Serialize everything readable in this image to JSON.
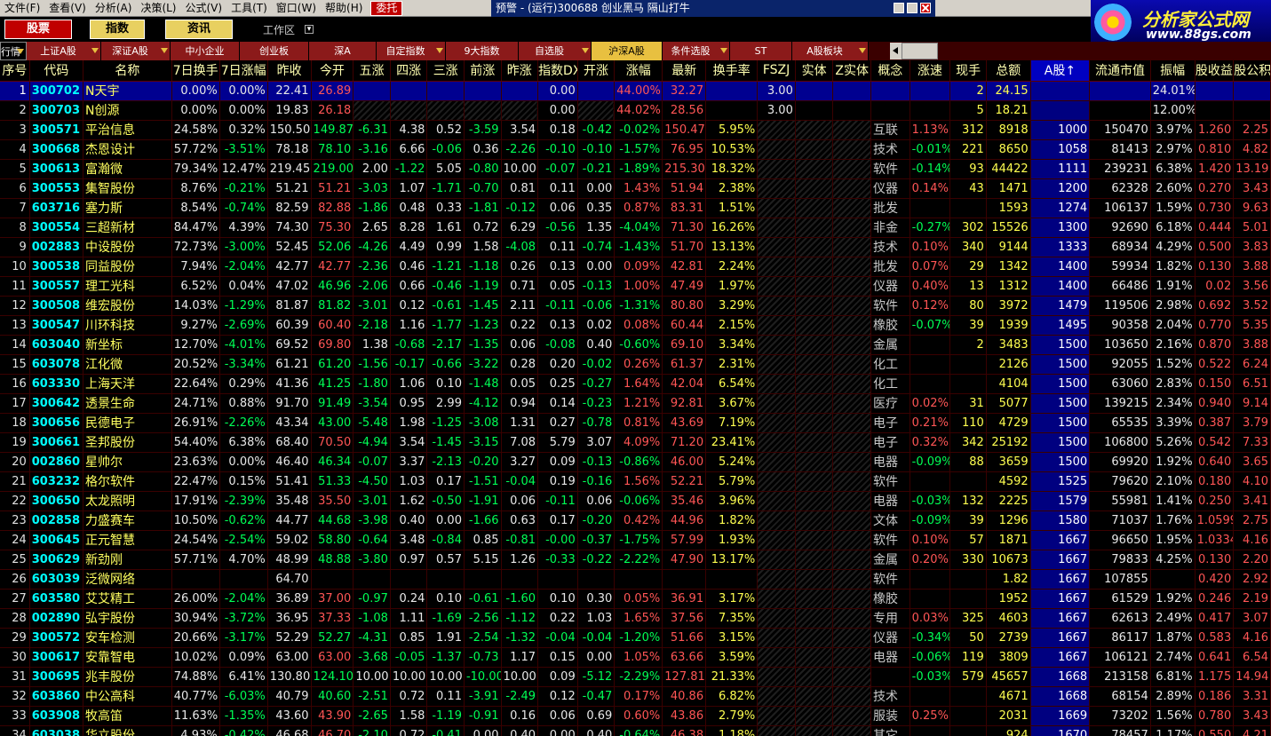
{
  "menu": {
    "items": [
      "文件(F)",
      "查看(V)",
      "分析(A)",
      "决策(L)",
      "公式(V)",
      "工具(T)",
      "窗口(W)",
      "帮助(H)"
    ],
    "active": "委托"
  },
  "window": {
    "title": "预警 - (运行)300688  创业黑马  隔山打牛"
  },
  "logo": {
    "name": "分析家公式网",
    "url": "www.88gs.com"
  },
  "toolbar": {
    "stock": "股票",
    "index": "指数",
    "info": "资讯",
    "workspace": "工作区"
  },
  "tabs": [
    {
      "label": "行情",
      "drop": true,
      "first": true
    },
    {
      "label": "上证A股",
      "drop": true
    },
    {
      "label": "深证A股",
      "drop": true
    },
    {
      "label": "中小企业",
      "drop": false
    },
    {
      "label": "创业板",
      "drop": false
    },
    {
      "label": "深A",
      "drop": false
    },
    {
      "label": "自定指数",
      "drop": true
    },
    {
      "label": "9大指数",
      "drop": false
    },
    {
      "label": "自选股",
      "drop": true
    },
    {
      "label": "沪深A股",
      "drop": false,
      "active": true
    },
    {
      "label": "条件选股",
      "drop": true
    },
    {
      "label": "ST",
      "drop": false
    },
    {
      "label": "A股板块",
      "drop": true
    }
  ],
  "columns": [
    "序号",
    "代码",
    "名称",
    "7日换手",
    "7日涨幅",
    "昨收",
    "今开",
    "五涨",
    "四涨",
    "三涨",
    "前涨",
    "昨涨",
    "指数DX",
    "开涨",
    "涨幅",
    "最新",
    "换手率",
    "FSZJ",
    "实体",
    "Z实体",
    "概念",
    "涨速",
    "现手",
    "总额",
    "A股↑",
    "流通市值",
    "振幅",
    "股收益",
    "股公积"
  ],
  "rows": [
    [
      "1",
      "300702",
      "N天宇",
      "0.00%",
      "0.00%",
      "22.41",
      "26.89",
      "",
      "",
      "",
      "",
      "",
      "0.00",
      "",
      "44.00%",
      "32.27",
      "",
      "3.00",
      "",
      "",
      "",
      "",
      "2",
      "24.15",
      "",
      "",
      "24.01%",
      "",
      ""
    ],
    [
      "2",
      "300703",
      "N创源",
      "0.00%",
      "0.00%",
      "19.83",
      "26.18",
      "",
      "",
      "",
      "",
      "",
      "0.00",
      "",
      "44.02%",
      "28.56",
      "",
      "3.00",
      "",
      "",
      "",
      "",
      "5",
      "18.21",
      "",
      "",
      "12.00%",
      "",
      ""
    ],
    [
      "3",
      "300571",
      "平治信息",
      "24.58%",
      "0.32%",
      "150.50",
      "149.87",
      "-6.31",
      "4.38",
      "0.52",
      "-3.59",
      "3.54",
      "0.18",
      "-0.42",
      "-0.02%",
      "150.47",
      "5.95%",
      "",
      "",
      "",
      "互联",
      "1.13%",
      "312",
      "8918",
      "1000",
      "150470",
      "3.97%",
      "1.260",
      "2.25"
    ],
    [
      "4",
      "300668",
      "杰恩设计",
      "57.72%",
      "-3.51%",
      "78.18",
      "78.10",
      "-3.16",
      "6.66",
      "-0.06",
      "0.36",
      "-2.26",
      "-0.10",
      "-0.10",
      "-1.57%",
      "76.95",
      "10.53%",
      "",
      "",
      "",
      "技术",
      "-0.01%",
      "221",
      "8650",
      "1058",
      "81413",
      "2.97%",
      "0.810",
      "4.82"
    ],
    [
      "5",
      "300613",
      "富瀚微",
      "79.34%",
      "12.47%",
      "219.45",
      "219.00",
      "2.00",
      "-1.22",
      "5.05",
      "-0.80",
      "10.00",
      "-0.07",
      "-0.21",
      "-1.89%",
      "215.30",
      "18.32%",
      "",
      "",
      "",
      "软件",
      "-0.14%",
      "93",
      "44422",
      "1111",
      "239231",
      "6.38%",
      "1.420",
      "13.19"
    ],
    [
      "6",
      "300553",
      "集智股份",
      "8.76%",
      "-0.21%",
      "51.21",
      "51.21",
      "-3.03",
      "1.07",
      "-1.71",
      "-0.70",
      "0.81",
      "0.11",
      "0.00",
      "1.43%",
      "51.94",
      "2.38%",
      "",
      "",
      "",
      "仪器",
      "0.14%",
      "43",
      "1471",
      "1200",
      "62328",
      "2.60%",
      "0.270",
      "3.43"
    ],
    [
      "7",
      "603716",
      "塞力斯",
      "8.54%",
      "-0.74%",
      "82.59",
      "82.88",
      "-1.86",
      "0.48",
      "0.33",
      "-1.81",
      "-0.12",
      "0.06",
      "0.35",
      "0.87%",
      "83.31",
      "1.51%",
      "",
      "",
      "",
      "批发",
      "",
      "",
      "1593",
      "1274",
      "106137",
      "1.59%",
      "0.730",
      "9.63"
    ],
    [
      "8",
      "300554",
      "三超新材",
      "84.47%",
      "4.39%",
      "74.30",
      "75.30",
      "2.65",
      "8.28",
      "1.61",
      "0.72",
      "6.29",
      "-0.56",
      "1.35",
      "-4.04%",
      "71.30",
      "16.26%",
      "",
      "",
      "",
      "非金",
      "-0.27%",
      "302",
      "15526",
      "1300",
      "92690",
      "6.18%",
      "0.444",
      "5.01"
    ],
    [
      "9",
      "002883",
      "中设股份",
      "72.73%",
      "-3.00%",
      "52.45",
      "52.06",
      "-4.26",
      "4.49",
      "0.99",
      "1.58",
      "-4.08",
      "0.11",
      "-0.74",
      "-1.43%",
      "51.70",
      "13.13%",
      "",
      "",
      "",
      "技术",
      "0.10%",
      "340",
      "9144",
      "1333",
      "68934",
      "4.29%",
      "0.500",
      "3.83"
    ],
    [
      "10",
      "300538",
      "同益股份",
      "7.94%",
      "-2.04%",
      "42.77",
      "42.77",
      "-2.36",
      "0.46",
      "-1.21",
      "-1.18",
      "0.26",
      "0.13",
      "0.00",
      "0.09%",
      "42.81",
      "2.24%",
      "",
      "",
      "",
      "批发",
      "0.07%",
      "29",
      "1342",
      "1400",
      "59934",
      "1.82%",
      "0.130",
      "3.88"
    ],
    [
      "11",
      "300557",
      "理工光科",
      "6.52%",
      "0.04%",
      "47.02",
      "46.96",
      "-2.06",
      "0.66",
      "-0.46",
      "-1.19",
      "0.71",
      "0.05",
      "-0.13",
      "1.00%",
      "47.49",
      "1.97%",
      "",
      "",
      "",
      "仪器",
      "0.40%",
      "13",
      "1312",
      "1400",
      "66486",
      "1.91%",
      "0.02",
      "3.56"
    ],
    [
      "12",
      "300508",
      "维宏股份",
      "14.03%",
      "-1.29%",
      "81.87",
      "81.82",
      "-3.01",
      "0.12",
      "-0.61",
      "-1.45",
      "2.11",
      "-0.11",
      "-0.06",
      "-1.31%",
      "80.80",
      "3.29%",
      "",
      "",
      "",
      "软件",
      "0.12%",
      "80",
      "3972",
      "1479",
      "119506",
      "2.98%",
      "0.692",
      "3.52"
    ],
    [
      "13",
      "300547",
      "川环科技",
      "9.27%",
      "-2.69%",
      "60.39",
      "60.40",
      "-2.18",
      "1.16",
      "-1.77",
      "-1.23",
      "0.22",
      "0.13",
      "0.02",
      "0.08%",
      "60.44",
      "2.15%",
      "",
      "",
      "",
      "橡胶",
      "-0.07%",
      "39",
      "1939",
      "1495",
      "90358",
      "2.04%",
      "0.770",
      "5.35"
    ],
    [
      "14",
      "603040",
      "新坐标",
      "12.70%",
      "-4.01%",
      "69.52",
      "69.80",
      "1.38",
      "-0.68",
      "-2.17",
      "-1.35",
      "0.06",
      "-0.08",
      "0.40",
      "-0.60%",
      "69.10",
      "3.34%",
      "",
      "",
      "",
      "金属",
      "",
      "2",
      "3483",
      "1500",
      "103650",
      "2.16%",
      "0.870",
      "3.88"
    ],
    [
      "15",
      "603078",
      "江化微",
      "20.52%",
      "-3.34%",
      "61.21",
      "61.20",
      "-1.56",
      "-0.17",
      "-0.66",
      "-3.22",
      "0.28",
      "0.20",
      "-0.02",
      "0.26%",
      "61.37",
      "2.31%",
      "",
      "",
      "",
      "化工",
      "",
      "",
      "2126",
      "1500",
      "92055",
      "1.52%",
      "0.522",
      "6.24"
    ],
    [
      "16",
      "603330",
      "上海天洋",
      "22.64%",
      "0.29%",
      "41.36",
      "41.25",
      "-1.80",
      "1.06",
      "0.10",
      "-1.48",
      "0.05",
      "0.25",
      "-0.27",
      "1.64%",
      "42.04",
      "6.54%",
      "",
      "",
      "",
      "化工",
      "",
      "",
      "4104",
      "1500",
      "63060",
      "2.83%",
      "0.150",
      "6.51"
    ],
    [
      "17",
      "300642",
      "透景生命",
      "24.71%",
      "0.88%",
      "91.70",
      "91.49",
      "-3.54",
      "0.95",
      "2.99",
      "-4.12",
      "0.94",
      "0.14",
      "-0.23",
      "1.21%",
      "92.81",
      "3.67%",
      "",
      "",
      "",
      "医疗",
      "0.02%",
      "31",
      "5077",
      "1500",
      "139215",
      "2.34%",
      "0.940",
      "9.14"
    ],
    [
      "18",
      "300656",
      "民德电子",
      "26.91%",
      "-2.26%",
      "43.34",
      "43.00",
      "-5.48",
      "1.98",
      "-1.25",
      "-3.08",
      "1.31",
      "0.27",
      "-0.78",
      "0.81%",
      "43.69",
      "7.19%",
      "",
      "",
      "",
      "电子",
      "0.21%",
      "110",
      "4729",
      "1500",
      "65535",
      "3.39%",
      "0.387",
      "3.79"
    ],
    [
      "19",
      "300661",
      "圣邦股份",
      "54.40%",
      "6.38%",
      "68.40",
      "70.50",
      "-4.94",
      "3.54",
      "-1.45",
      "-3.15",
      "7.08",
      "5.79",
      "3.07",
      "4.09%",
      "71.20",
      "23.41%",
      "",
      "",
      "",
      "电子",
      "0.32%",
      "342",
      "25192",
      "1500",
      "106800",
      "5.26%",
      "0.542",
      "7.33"
    ],
    [
      "20",
      "002860",
      "星帅尔",
      "23.63%",
      "0.00%",
      "46.40",
      "46.34",
      "-0.07",
      "3.37",
      "-2.13",
      "-0.20",
      "3.27",
      "0.09",
      "-0.13",
      "-0.86%",
      "46.00",
      "5.24%",
      "",
      "",
      "",
      "电器",
      "-0.09%",
      "88",
      "3659",
      "1500",
      "69920",
      "1.92%",
      "0.640",
      "3.65"
    ],
    [
      "21",
      "603232",
      "格尔软件",
      "22.47%",
      "0.15%",
      "51.41",
      "51.33",
      "-4.50",
      "1.03",
      "0.17",
      "-1.51",
      "-0.04",
      "0.19",
      "-0.16",
      "1.56%",
      "52.21",
      "5.79%",
      "",
      "",
      "",
      "软件",
      "",
      "",
      "4592",
      "1525",
      "79620",
      "2.10%",
      "0.180",
      "4.10"
    ],
    [
      "22",
      "300650",
      "太龙照明",
      "17.91%",
      "-2.39%",
      "35.48",
      "35.50",
      "-3.01",
      "1.62",
      "-0.50",
      "-1.91",
      "0.06",
      "-0.11",
      "0.06",
      "-0.06%",
      "35.46",
      "3.96%",
      "",
      "",
      "",
      "电器",
      "-0.03%",
      "132",
      "2225",
      "1579",
      "55981",
      "1.41%",
      "0.250",
      "3.41"
    ],
    [
      "23",
      "002858",
      "力盛赛车",
      "10.50%",
      "-0.62%",
      "44.77",
      "44.68",
      "-3.98",
      "0.40",
      "0.00",
      "-1.66",
      "0.63",
      "0.17",
      "-0.20",
      "0.42%",
      "44.96",
      "1.82%",
      "",
      "",
      "",
      "文体",
      "-0.09%",
      "39",
      "1296",
      "1580",
      "71037",
      "1.76%",
      "1.0599",
      "2.75"
    ],
    [
      "24",
      "300645",
      "正元智慧",
      "24.54%",
      "-2.54%",
      "59.02",
      "58.80",
      "-0.64",
      "3.48",
      "-0.84",
      "0.85",
      "-0.81",
      "-0.00",
      "-0.37",
      "-1.75%",
      "57.99",
      "1.93%",
      "",
      "",
      "",
      "软件",
      "0.10%",
      "57",
      "1871",
      "1667",
      "96650",
      "1.95%",
      "1.0334",
      "4.16"
    ],
    [
      "25",
      "300629",
      "新劲刚",
      "57.71%",
      "4.70%",
      "48.99",
      "48.88",
      "-3.80",
      "0.97",
      "0.57",
      "5.15",
      "1.26",
      "-0.33",
      "-0.22",
      "-2.22%",
      "47.90",
      "13.17%",
      "",
      "",
      "",
      "金属",
      "0.20%",
      "330",
      "10673",
      "1667",
      "79833",
      "4.25%",
      "0.130",
      "2.20"
    ],
    [
      "26",
      "603039",
      "泛微网络",
      "",
      "",
      "64.70",
      "",
      "",
      "",
      "",
      "",
      "",
      "",
      "",
      "",
      "",
      "",
      "",
      "",
      "",
      "软件",
      "",
      "",
      "1.82",
      "1667",
      "107855",
      "",
      "0.420",
      "2.92"
    ],
    [
      "27",
      "603580",
      "艾艾精工",
      "26.00%",
      "-2.04%",
      "36.89",
      "37.00",
      "-0.97",
      "0.24",
      "0.10",
      "-0.61",
      "-1.60",
      "0.10",
      "0.30",
      "0.05%",
      "36.91",
      "3.17%",
      "",
      "",
      "",
      "橡胶",
      "",
      "",
      "1952",
      "1667",
      "61529",
      "1.92%",
      "0.246",
      "2.19"
    ],
    [
      "28",
      "002890",
      "弘宇股份",
      "30.94%",
      "-3.72%",
      "36.95",
      "37.33",
      "-1.08",
      "1.11",
      "-1.69",
      "-2.56",
      "-1.12",
      "0.22",
      "1.03",
      "1.65%",
      "37.56",
      "7.35%",
      "",
      "",
      "",
      "专用",
      "0.03%",
      "325",
      "4603",
      "1667",
      "62613",
      "2.49%",
      "0.417",
      "3.07"
    ],
    [
      "29",
      "300572",
      "安车检测",
      "20.66%",
      "-3.17%",
      "52.29",
      "52.27",
      "-4.31",
      "0.85",
      "1.91",
      "-2.54",
      "-1.32",
      "-0.04",
      "-0.04",
      "-1.20%",
      "51.66",
      "3.15%",
      "",
      "",
      "",
      "仪器",
      "-0.34%",
      "50",
      "2739",
      "1667",
      "86117",
      "1.87%",
      "0.583",
      "4.16"
    ],
    [
      "30",
      "300617",
      "安靠智电",
      "10.02%",
      "0.09%",
      "63.00",
      "63.00",
      "-3.68",
      "-0.05",
      "-1.37",
      "-0.73",
      "1.17",
      "0.15",
      "0.00",
      "1.05%",
      "63.66",
      "3.59%",
      "",
      "",
      "",
      "电器",
      "-0.06%",
      "119",
      "3809",
      "1667",
      "106121",
      "2.74%",
      "0.641",
      "6.54"
    ],
    [
      "31",
      "300695",
      "兆丰股份",
      "74.88%",
      "6.41%",
      "130.80",
      "124.10",
      "10.00",
      "10.00",
      "10.00",
      "-10.00",
      "10.00",
      "0.09",
      "-5.12",
      "-2.29%",
      "127.81",
      "21.33%",
      "",
      "",
      "",
      "",
      "-0.03%",
      "579",
      "45657",
      "1668",
      "213158",
      "6.81%",
      "1.175",
      "14.94"
    ],
    [
      "32",
      "603860",
      "中公高科",
      "40.77%",
      "-6.03%",
      "40.79",
      "40.60",
      "-2.51",
      "0.72",
      "0.11",
      "-3.91",
      "-2.49",
      "0.12",
      "-0.47",
      "0.17%",
      "40.86",
      "6.82%",
      "",
      "",
      "",
      "技术",
      "",
      "",
      "4671",
      "1668",
      "68154",
      "2.89%",
      "0.186",
      "3.31"
    ],
    [
      "33",
      "603908",
      "牧高笛",
      "11.63%",
      "-1.35%",
      "43.60",
      "43.90",
      "-2.65",
      "1.58",
      "-1.19",
      "-0.91",
      "0.16",
      "0.06",
      "0.69",
      "0.60%",
      "43.86",
      "2.79%",
      "",
      "",
      "",
      "服装",
      "0.25%",
      "",
      "2031",
      "1669",
      "73202",
      "1.56%",
      "0.780",
      "3.43"
    ],
    [
      "34",
      "603038",
      "华立股份",
      "4.93%",
      "-0.42%",
      "46.68",
      "46.70",
      "-2.10",
      "0.72",
      "-0.41",
      "0.00",
      "0.40",
      "0.00",
      "0.40",
      "-0.64%",
      "46.38",
      "1.18%",
      "",
      "",
      "",
      "其它",
      "",
      "",
      "924",
      "1670",
      "78457",
      "1.17%",
      "0.550",
      "4.21"
    ]
  ]
}
